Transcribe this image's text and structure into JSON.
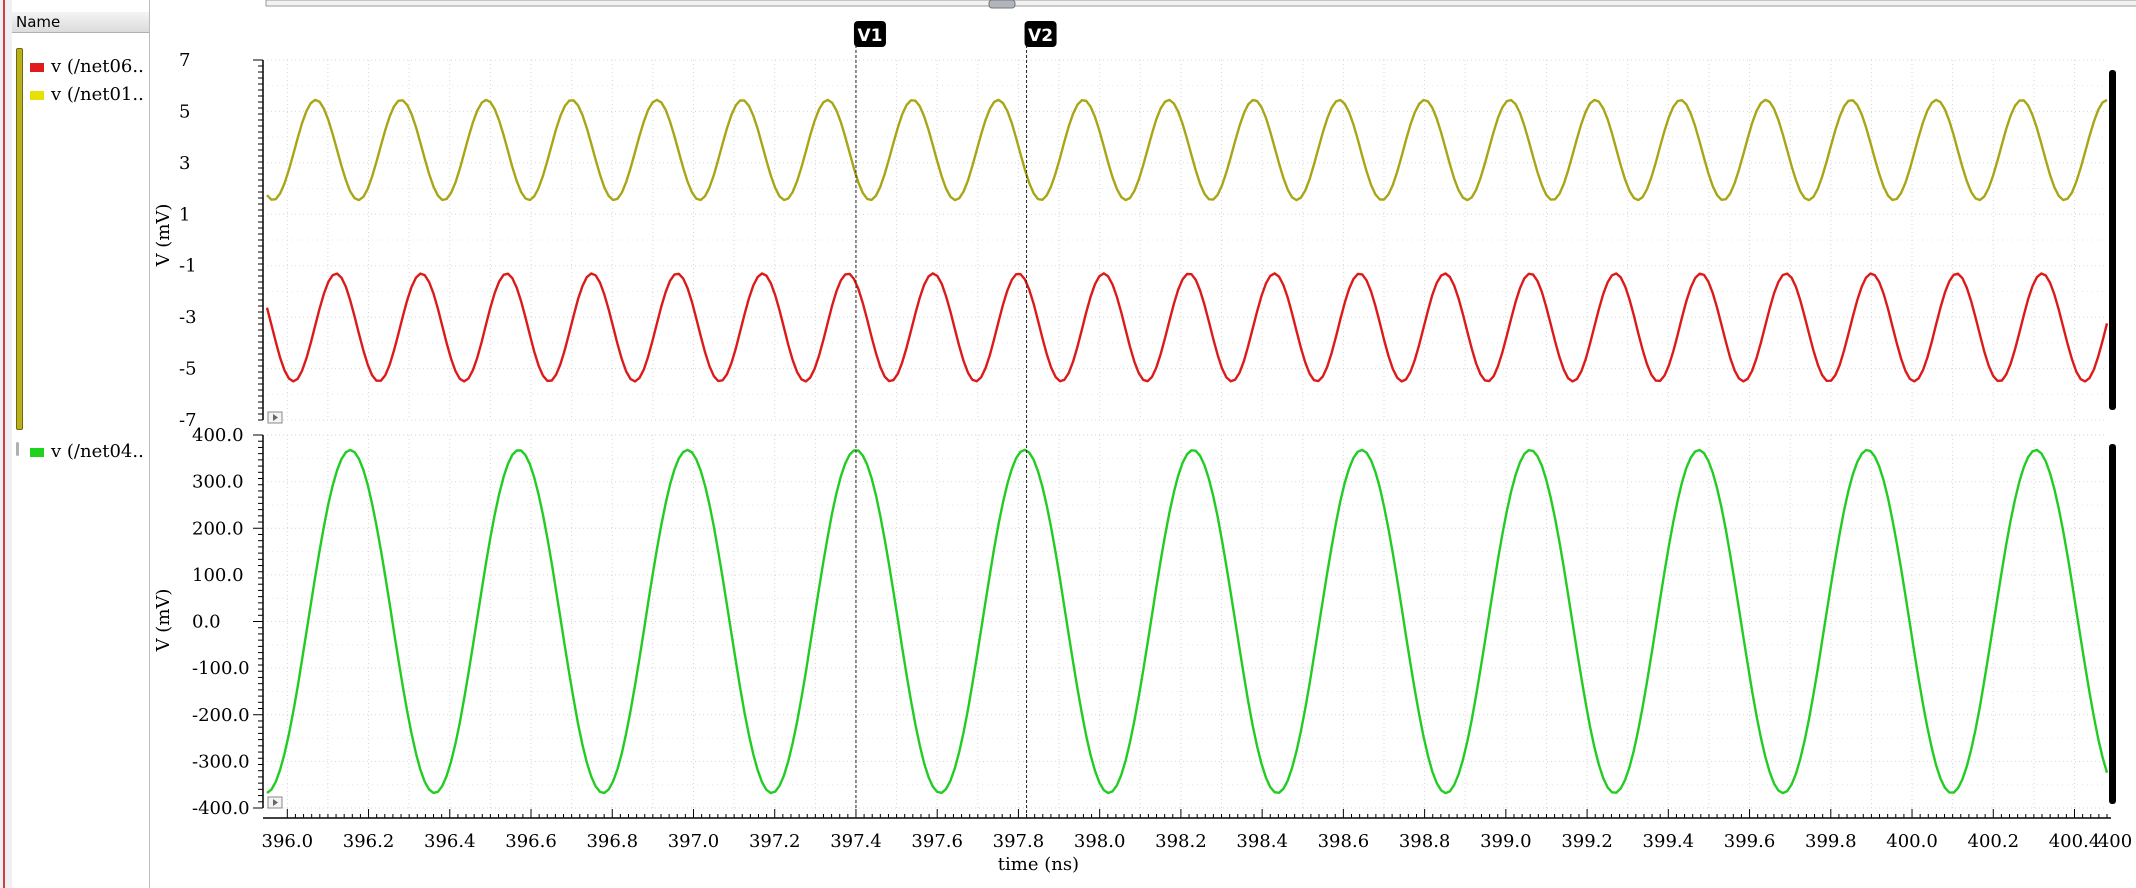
{
  "sidebar": {
    "header": "Name",
    "traces": [
      {
        "label": "v (/net06..",
        "color": "#e01a1a"
      },
      {
        "label": "v (/net01..",
        "color": "#e8e000"
      },
      {
        "label": "v (/net04..",
        "color": "#1ed21e"
      }
    ]
  },
  "markers": [
    {
      "label": "V1",
      "x": 397.4
    },
    {
      "label": "V2",
      "x": 397.82
    }
  ],
  "chart_data": [
    {
      "type": "line",
      "ylabel": "V (mV)",
      "ylim": [
        -7,
        7
      ],
      "yticks": [
        7,
        5,
        3,
        1,
        -1,
        -3,
        -5,
        -7
      ],
      "xlim": [
        395.95,
        400.48
      ],
      "grid": true,
      "series": [
        {
          "name": "v (/net01..",
          "color": "#a8a616",
          "offset": 3.5,
          "amplitude": 1.95,
          "period": 0.21,
          "phase_peak_at": 396.07
        },
        {
          "name": "v (/net06..",
          "color": "#dd1a1a",
          "offset": -3.4,
          "amplitude": 2.1,
          "period": 0.21,
          "phase_peak_at": 396.12
        }
      ]
    },
    {
      "type": "line",
      "ylabel": "V (mV)",
      "ylim": [
        -400,
        400
      ],
      "yticks": [
        "400.0",
        "300.0",
        "200.0",
        "100.0",
        "0.0",
        "-100.0",
        "-200.0",
        "-300.0",
        "-400.0"
      ],
      "xlim": [
        395.95,
        400.48
      ],
      "xlabel": "time (ns)",
      "xticks": [
        "396.0",
        "396.2",
        "396.4",
        "396.6",
        "396.8",
        "397.0",
        "397.2",
        "397.4",
        "397.6",
        "397.8",
        "398.0",
        "398.2",
        "398.4",
        "398.6",
        "398.8",
        "399.0",
        "399.2",
        "399.4",
        "399.6",
        "399.8",
        "400.0",
        "400.2",
        "400.4",
        "400"
      ],
      "grid": true,
      "series": [
        {
          "name": "v (/net04..",
          "color": "#22cc22",
          "offset": 0,
          "amplitude": 368,
          "period": 0.415,
          "phase_peak_at": 396.155
        }
      ]
    }
  ]
}
